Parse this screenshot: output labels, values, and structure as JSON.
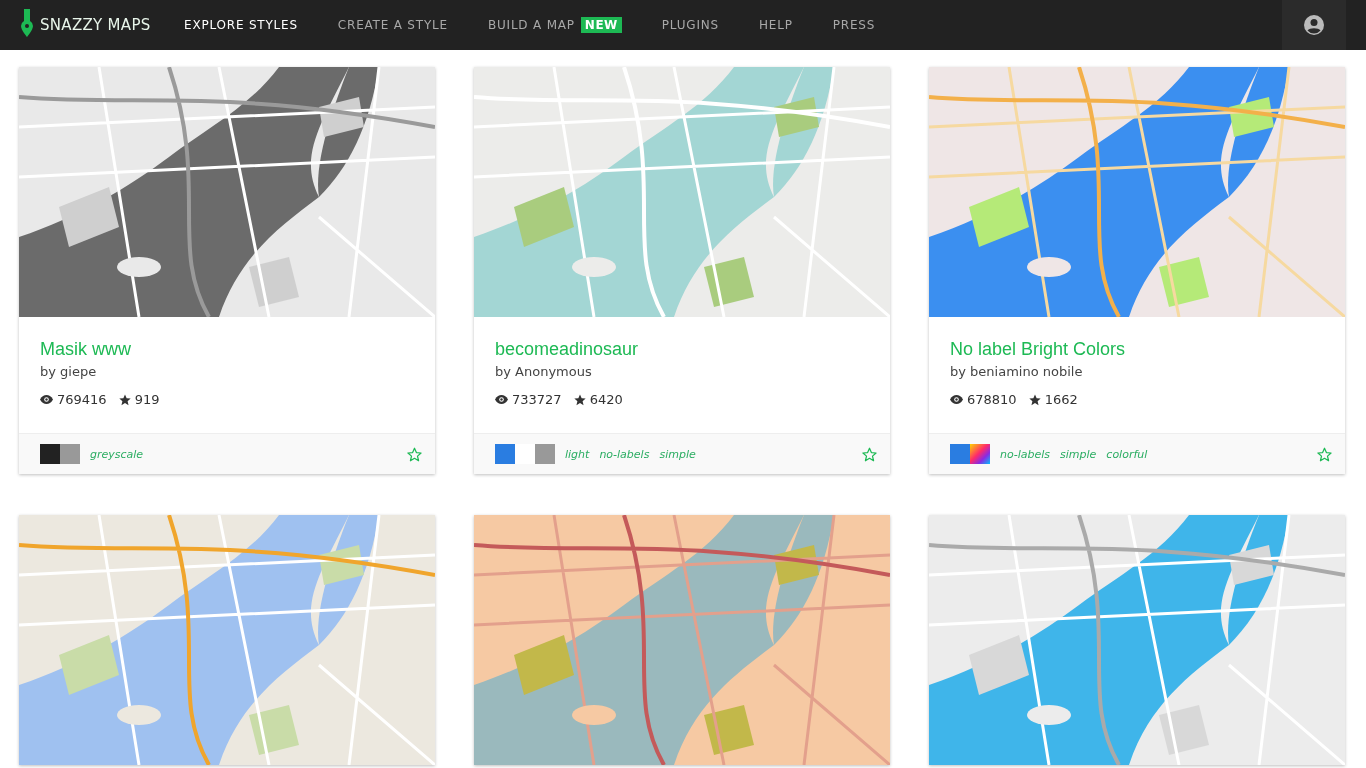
{
  "brand": "SNAZZY MAPS",
  "nav": [
    {
      "label": "EXPLORE STYLES",
      "selected": true
    },
    {
      "label": "CREATE A STYLE",
      "selected": false
    },
    {
      "label": "BUILD A MAP",
      "selected": false,
      "badge": "NEW"
    },
    {
      "label": "PLUGINS",
      "selected": false
    },
    {
      "label": "HELP",
      "selected": false
    },
    {
      "label": "PRESS",
      "selected": false
    }
  ],
  "cards": [
    {
      "image": {
        "kind": "picture"
      },
      "title": "Masik www",
      "author": "by giepe",
      "views": "769416",
      "stars_count": "919",
      "swatches": [
        {
          "kind": "solid",
          "color": "#222222"
        },
        {
          "kind": "solid",
          "color": "#999999"
        }
      ],
      "tags": [
        "greyscale"
      ],
      "favorite": false
    },
    {
      "image": {
        "kind": "picture"
      },
      "title": "becomeadinosaur",
      "author": "by Anonymous",
      "views": "733727",
      "stars_count": "6420",
      "swatches": [
        {
          "kind": "solid",
          "color": "#2a7de1"
        },
        {
          "kind": "solid",
          "color": "#ffffff"
        },
        {
          "kind": "solid",
          "color": "#999999"
        }
      ],
      "tags": [
        "light",
        "no-labels",
        "simple"
      ],
      "favorite": false
    },
    {
      "image": {
        "kind": "picture"
      },
      "title": "No label Bright Colors",
      "author": "by beniamino nobile",
      "views": "678810",
      "stars_count": "1662",
      "swatches": [
        {
          "kind": "solid",
          "color": "#2a7de1"
        },
        {
          "kind": "rainbow"
        }
      ],
      "tags": [
        "no-labels",
        "simple",
        "colorful"
      ],
      "favorite": false
    },
    {
      "image": {
        "kind": "picture"
      }
    },
    {
      "image": {
        "kind": "picture"
      }
    },
    {
      "image": {
        "kind": "picture"
      }
    }
  ]
}
